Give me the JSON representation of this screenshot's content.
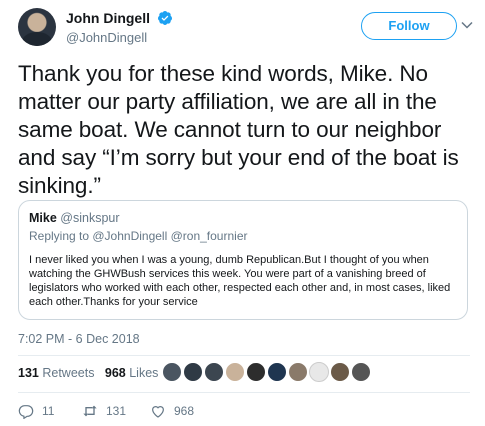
{
  "author": {
    "name": "John Dingell",
    "handle": "@JohnDingell"
  },
  "follow_label": "Follow",
  "tweet": {
    "text": "Thank you for these kind words, Mike. No matter our party affiliation, we are all in the same boat. We cannot turn to our neighbor and say “I’m sorry but your end of the boat is sinking.”"
  },
  "quote": {
    "name": "Mike",
    "handle": "@sinkspur",
    "replying_prefix": "Replying to ",
    "replying_to": "@JohnDingell @ron_fournier",
    "text": "I never liked you when I was a young, dumb Republican.But I thought of you when watching the GHWBush services this week. You were part of a vanishing breed of legislators who worked with each other, respected each other and, in most cases, liked each other.Thanks for your service"
  },
  "timestamp": "7:02 PM - 6 Dec 2018",
  "stats": {
    "retweets_count": "131",
    "retweets_label": "Retweets",
    "likes_count": "968",
    "likes_label": "Likes"
  },
  "actions": {
    "reply_count": "11",
    "retweet_count": "131",
    "like_count": "968"
  },
  "colors": {
    "accent": "#1da1f2",
    "secondary_text": "#657786",
    "border": "#ccd6dd"
  },
  "icons": [
    "verified-badge-icon",
    "chevron-down-icon",
    "reply-icon",
    "retweet-icon",
    "like-icon"
  ]
}
